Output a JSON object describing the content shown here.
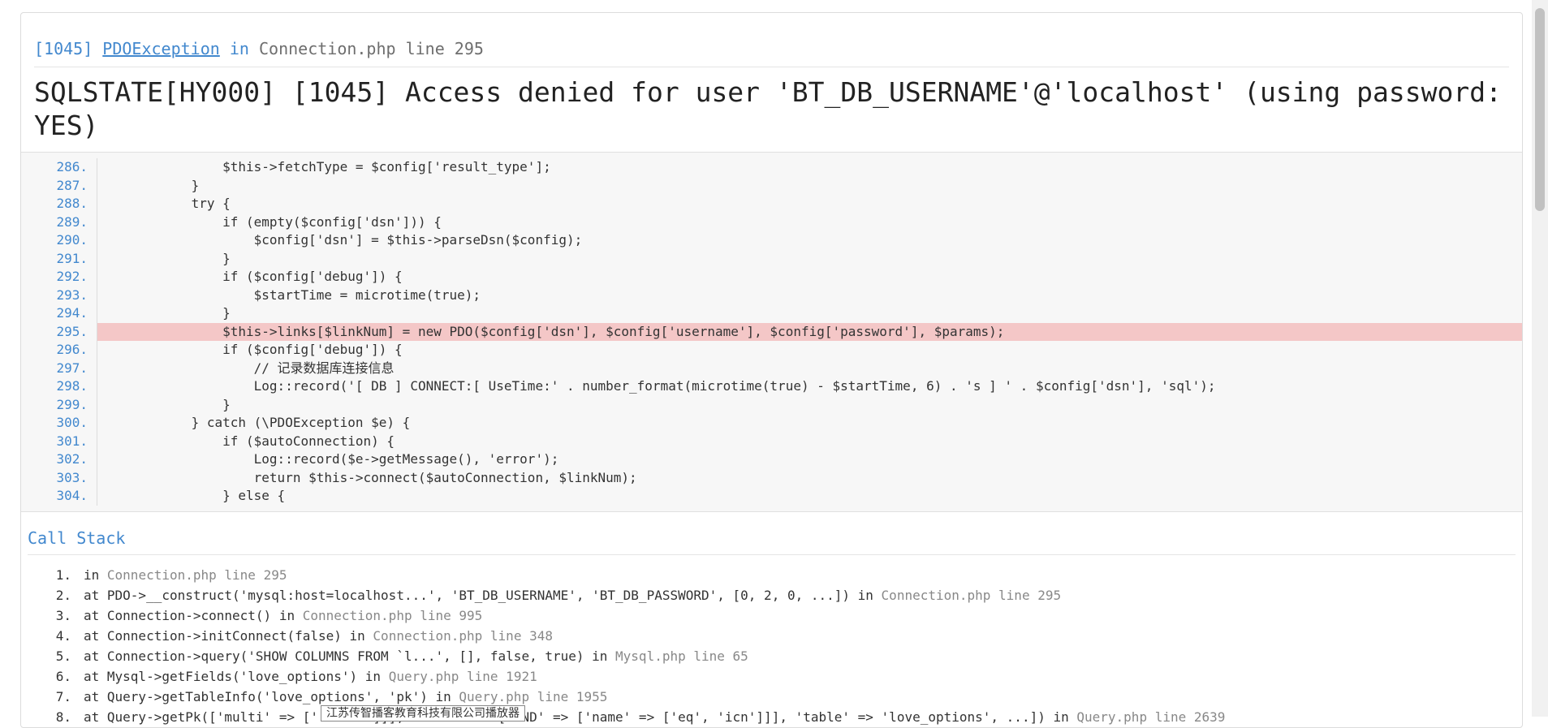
{
  "exception": {
    "code": "[1045]",
    "class_name": "PDOException",
    "in_word": "in",
    "location": "Connection.php line 295",
    "message": "SQLSTATE[HY000] [1045] Access denied for user 'BT_DB_USERNAME'@'localhost' (using password: YES)"
  },
  "source_lines": [
    {
      "num": "286.",
      "text": "                $this->fetchType = $config['result_type'];"
    },
    {
      "num": "287.",
      "text": "            }"
    },
    {
      "num": "288.",
      "text": "            try {"
    },
    {
      "num": "289.",
      "text": "                if (empty($config['dsn'])) {"
    },
    {
      "num": "290.",
      "text": "                    $config['dsn'] = $this->parseDsn($config);"
    },
    {
      "num": "291.",
      "text": "                }"
    },
    {
      "num": "292.",
      "text": "                if ($config['debug']) {"
    },
    {
      "num": "293.",
      "text": "                    $startTime = microtime(true);"
    },
    {
      "num": "294.",
      "text": "                }"
    },
    {
      "num": "295.",
      "text": "                $this->links[$linkNum] = new PDO($config['dsn'], $config['username'], $config['password'], $params);"
    },
    {
      "num": "296.",
      "text": "                if ($config['debug']) {"
    },
    {
      "num": "297.",
      "text": "                    // 记录数据库连接信息"
    },
    {
      "num": "298.",
      "text": "                    Log::record('[ DB ] CONNECT:[ UseTime:' . number_format(microtime(true) - $startTime, 6) . 's ] ' . $config['dsn'], 'sql');"
    },
    {
      "num": "299.",
      "text": "                }"
    },
    {
      "num": "300.",
      "text": "            } catch (\\PDOException $e) {"
    },
    {
      "num": "301.",
      "text": "                if ($autoConnection) {"
    },
    {
      "num": "302.",
      "text": "                    Log::record($e->getMessage(), 'error');"
    },
    {
      "num": "303.",
      "text": "                    return $this->connect($autoConnection, $linkNum);"
    },
    {
      "num": "304.",
      "text": "                } else {"
    }
  ],
  "highlight_line": "295.",
  "call_stack": {
    "title": "Call Stack",
    "items": [
      {
        "num": "1.",
        "text": "in ",
        "file": "Connection.php line 295"
      },
      {
        "num": "2.",
        "text": "at PDO->__construct('mysql:host=localhost...', 'BT_DB_USERNAME', 'BT_DB_PASSWORD', [0, 2, 0, ...]) in ",
        "file": "Connection.php line 295"
      },
      {
        "num": "3.",
        "text": "at Connection->connect() in ",
        "file": "Connection.php line 995"
      },
      {
        "num": "4.",
        "text": "at Connection->initConnect(false) in ",
        "file": "Connection.php line 348"
      },
      {
        "num": "5.",
        "text": "at Connection->query('SHOW COLUMNS FROM `l...', [], false, true) in ",
        "file": "Mysql.php line 65"
      },
      {
        "num": "6.",
        "text": "at Mysql->getFields('love_options') in ",
        "file": "Query.php line 1921"
      },
      {
        "num": "7.",
        "text": "at Query->getTableInfo('love_options', 'pk') in ",
        "file": "Query.php line 1955"
      },
      {
        "num": "8.",
        "text": "at Query->getPk(['multi' => ['...icn']]], 'where' => ['AND' => ['name' => ['eq', 'icn']]], 'table' => 'love_options', ...]) in ",
        "file": "Query.php line 2639"
      }
    ]
  },
  "tooltip": "江苏传智播客教育科技有限公司播放器"
}
